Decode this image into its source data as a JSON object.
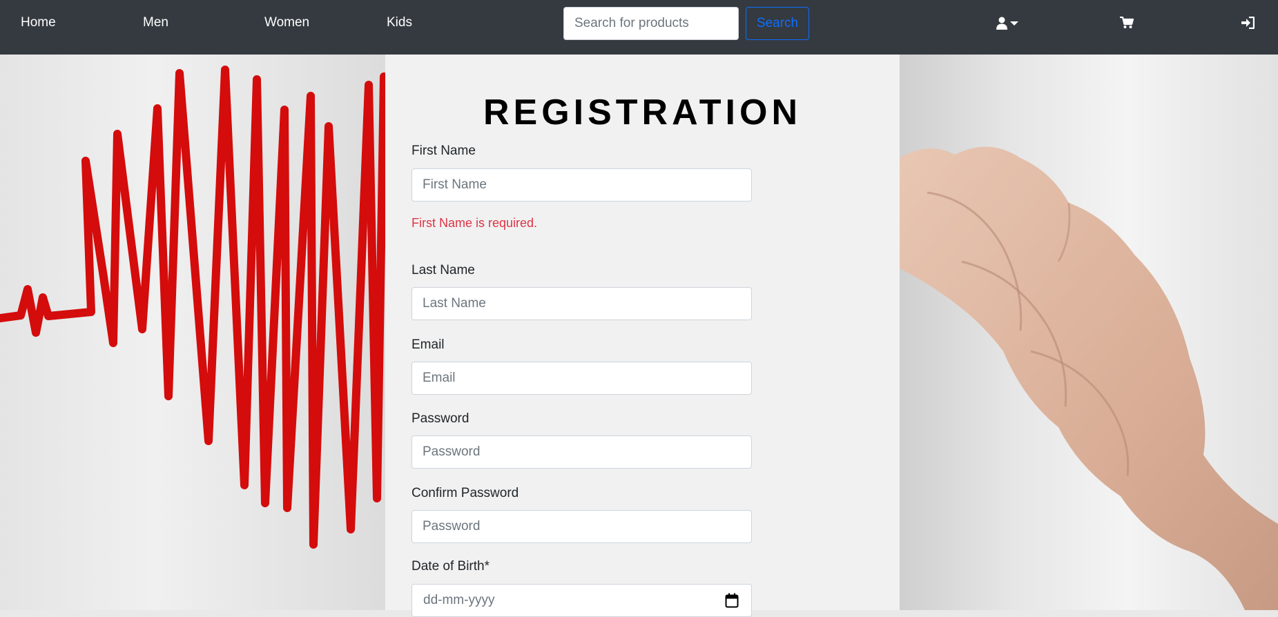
{
  "nav": {
    "links": [
      "Home",
      "Men",
      "Women",
      "Kids"
    ],
    "search_placeholder": "Search for products",
    "search_button": "Search",
    "icons": [
      "user-icon",
      "caret-down-icon",
      "cart-icon",
      "sign-in-icon"
    ]
  },
  "form": {
    "title": "REGISTRATION",
    "fields": [
      {
        "label": "First Name",
        "placeholder": "First Name"
      },
      {
        "label": "Last Name",
        "placeholder": "Last Name"
      },
      {
        "label": "Email",
        "placeholder": "Email"
      },
      {
        "label": "Password",
        "placeholder": "Password"
      },
      {
        "label": "Confirm Password",
        "placeholder": "Password"
      },
      {
        "label": "Date of Birth*",
        "placeholder": "dd-mm-yyyy"
      }
    ],
    "first_name_error": "First Name is required."
  },
  "colors": {
    "navbar": "#343a40",
    "primary": "#0d6efd",
    "error": "#dc3545",
    "panel": "#f1f1f1"
  }
}
